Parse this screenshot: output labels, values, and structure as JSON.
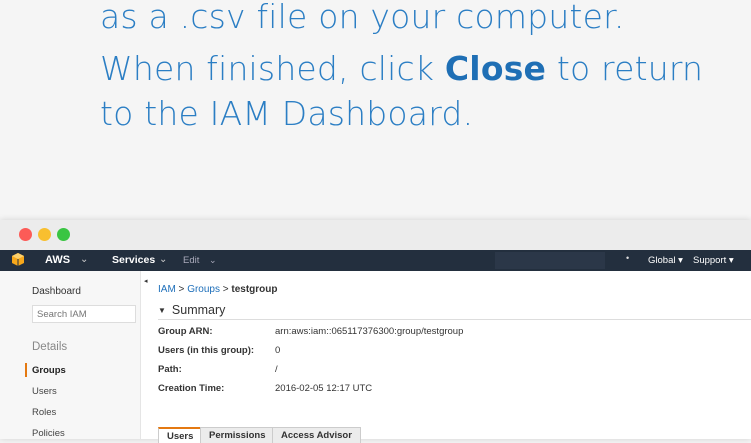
{
  "instructions": {
    "line1": "as a .csv file on your computer.",
    "line2_pre": "When finished, click ",
    "line2_bold": "Close",
    "line2_post": " to return",
    "line3": "to the IAM Dashboard."
  },
  "navbar": {
    "aws": "AWS",
    "services": "Services",
    "edit": "Edit",
    "caret": "⌄",
    "bullet": "•",
    "global": "Global ▾",
    "support": "Support ▾"
  },
  "sidebar": {
    "dashboard": "Dashboard",
    "search_placeholder": "Search IAM",
    "details": "Details",
    "items": [
      "Groups",
      "Users",
      "Roles",
      "Policies"
    ],
    "collapse": "◂"
  },
  "breadcrumb": {
    "iam": "IAM",
    "sep": " > ",
    "groups": "Groups",
    "current": "testgroup"
  },
  "summary": {
    "title": "Summary",
    "rows": [
      {
        "label": "Group ARN:",
        "value": "arn:aws:iam::065117376300:group/testgroup"
      },
      {
        "label": "Users (in this group):",
        "value": "0"
      },
      {
        "label": "Path:",
        "value": "/"
      },
      {
        "label": "Creation Time:",
        "value": "2016-02-05 12:17 UTC"
      }
    ]
  },
  "tabs": [
    "Users",
    "Permissions",
    "Access Advisor"
  ],
  "colors": {
    "accent": "#e47911",
    "nav": "#232f3e",
    "link": "#1e6fba",
    "instruction": "#2b7ec4"
  }
}
